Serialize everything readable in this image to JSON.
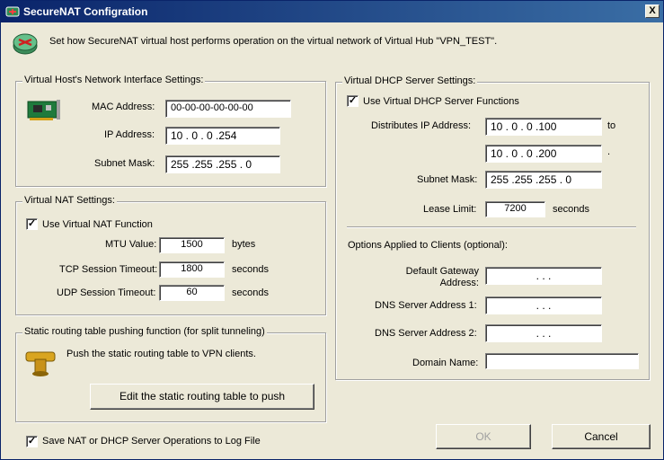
{
  "window": {
    "title": "SecureNAT Configration",
    "close_label": "X"
  },
  "header": {
    "description": "Set how SecureNAT virtual host performs operation on the virtual network of Virtual Hub \"VPN_TEST\"."
  },
  "host": {
    "group_label": "Virtual Host's Network Interface Settings:",
    "mac_label": "MAC Address:",
    "mac_value": "00-00-00-00-00-00",
    "ip_label": "IP Address:",
    "ip_value": "10 .  0  .  0  .254",
    "mask_label": "Subnet Mask:",
    "mask_value": "255 .255 .255 .  0"
  },
  "nat": {
    "group_label": "Virtual NAT Settings:",
    "use_label": "Use Virtual NAT Function",
    "mtu_label": "MTU Value:",
    "mtu_value": "1500",
    "mtu_unit": "bytes",
    "tcp_label": "TCP Session Timeout:",
    "tcp_value": "1800",
    "tcp_unit": "seconds",
    "udp_label": "UDP Session Timeout:",
    "udp_value": "60",
    "udp_unit": "seconds"
  },
  "routing": {
    "group_label": "Static routing table pushing function (for split tunneling)",
    "description": "Push the static routing table to VPN clients.",
    "edit_button": "Edit the static routing table to push"
  },
  "log": {
    "label": "Save NAT or DHCP Server Operations to Log File"
  },
  "dhcp": {
    "group_label": "Virtual DHCP Server Settings:",
    "use_label": "Use Virtual DHCP Server Functions",
    "dist_label": "Distributes IP Address:",
    "dist_from": "10 .  0  .  0  .100",
    "to_label": "to",
    "dist_to": "10 .  0  .  0  .200",
    "dot": ".",
    "mask_label": "Subnet Mask:",
    "mask_value": "255 .255 .255 .  0",
    "lease_label": "Lease Limit:",
    "lease_value": "7200",
    "lease_unit": "seconds",
    "options_label": "Options Applied to Clients (optional):",
    "gateway_label_1": "Default Gateway",
    "gateway_label_2": "Address:",
    "dns1_label": "DNS Server Address 1:",
    "dns2_label": "DNS Server Address 2:",
    "domain_label": "Domain Name:",
    "empty_ip": ".      .      .",
    "domain_value": ""
  },
  "buttons": {
    "ok": "OK",
    "cancel": "Cancel"
  }
}
